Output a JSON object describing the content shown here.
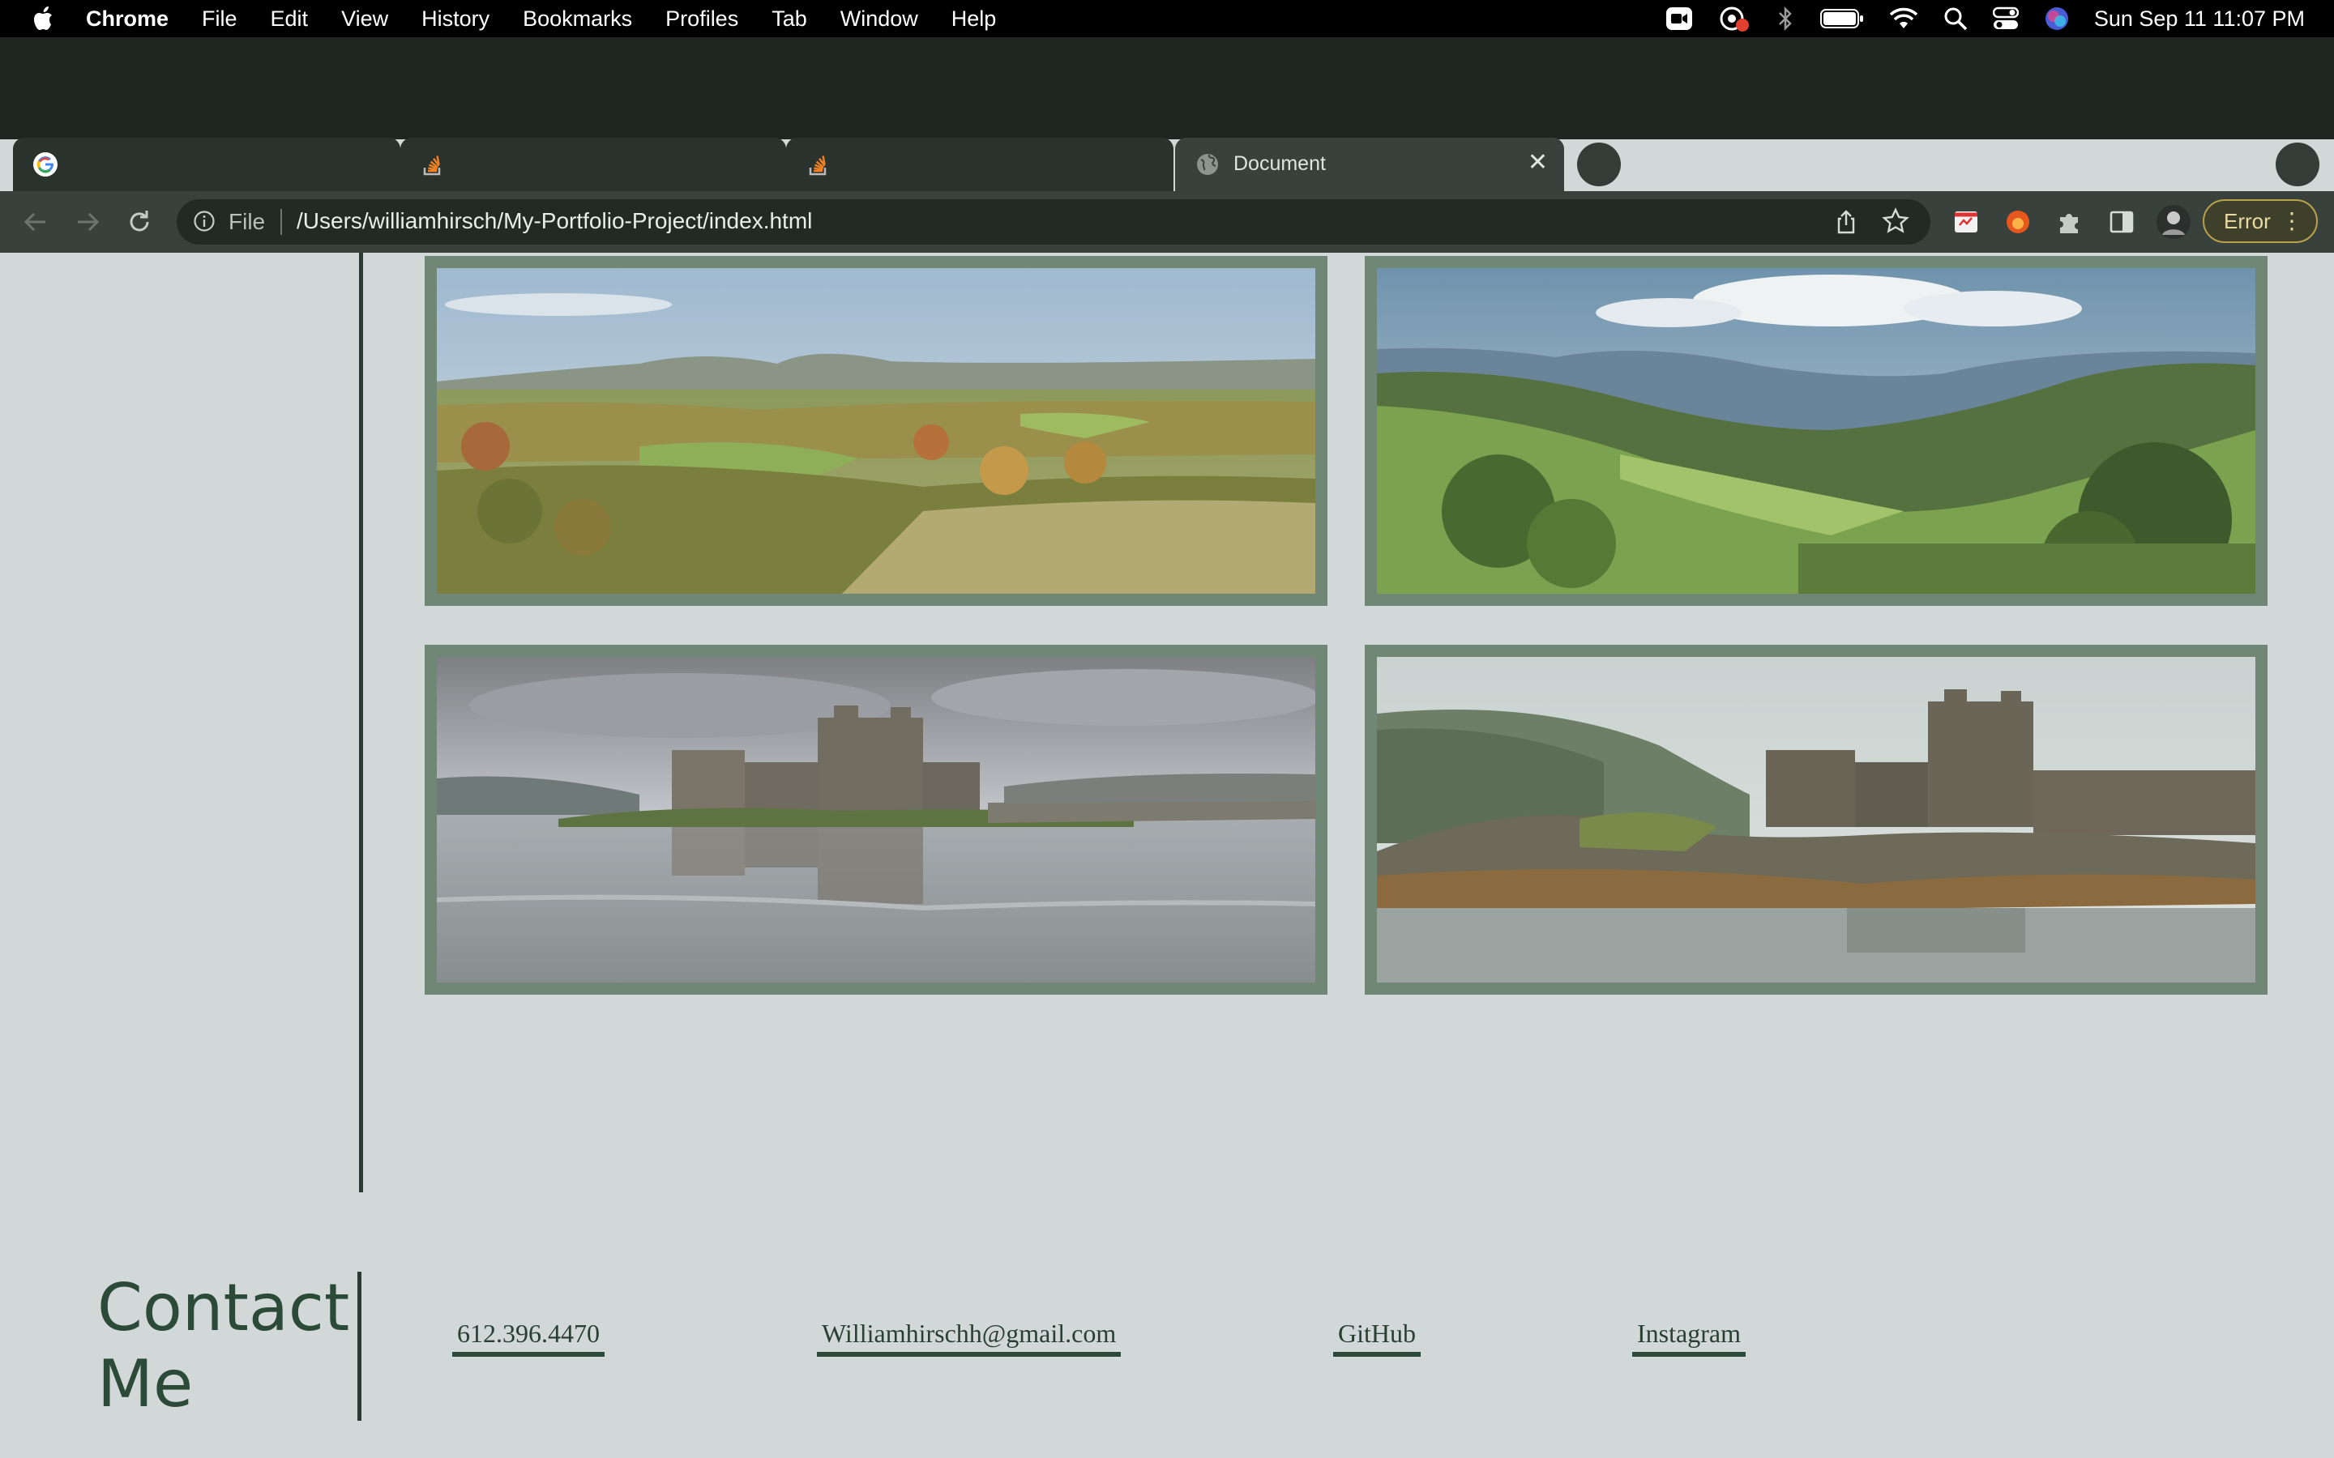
{
  "menubar": {
    "app": "Chrome",
    "items": [
      "File",
      "Edit",
      "View",
      "History",
      "Bookmarks",
      "Profiles",
      "Tab",
      "Window",
      "Help"
    ],
    "clock": "Sun Sep 11  11:07 PM"
  },
  "tabs": [
    {
      "title": "",
      "favicon": "google-icon"
    },
    {
      "title": "",
      "favicon": "stackoverflow-icon"
    },
    {
      "title": "",
      "favicon": "stackoverflow-icon"
    },
    {
      "title": "Document",
      "favicon": "globe-icon",
      "active": true
    }
  ],
  "address_bar": {
    "scheme": "File",
    "url": "/Users/williamhirsch/My-Portfolio-Project/index.html"
  },
  "error_button": {
    "label": "Error"
  },
  "gallery": {
    "images": [
      {
        "alt": "autumn countryside landscape"
      },
      {
        "alt": "green mountain valley"
      },
      {
        "alt": "castle reflected in loch"
      },
      {
        "alt": "castle on rocky shore in mist"
      }
    ]
  },
  "contact": {
    "title_line1": "Contact",
    "title_line2": "Me",
    "links": [
      "612.396.4470",
      "Williamhirschh@gmail.com",
      "GitHub",
      "Instagram"
    ]
  },
  "colors": {
    "page_bg": "#d2d8d7",
    "accent_dark_green": "#2b4a37",
    "photo_border": "#6f8774"
  }
}
